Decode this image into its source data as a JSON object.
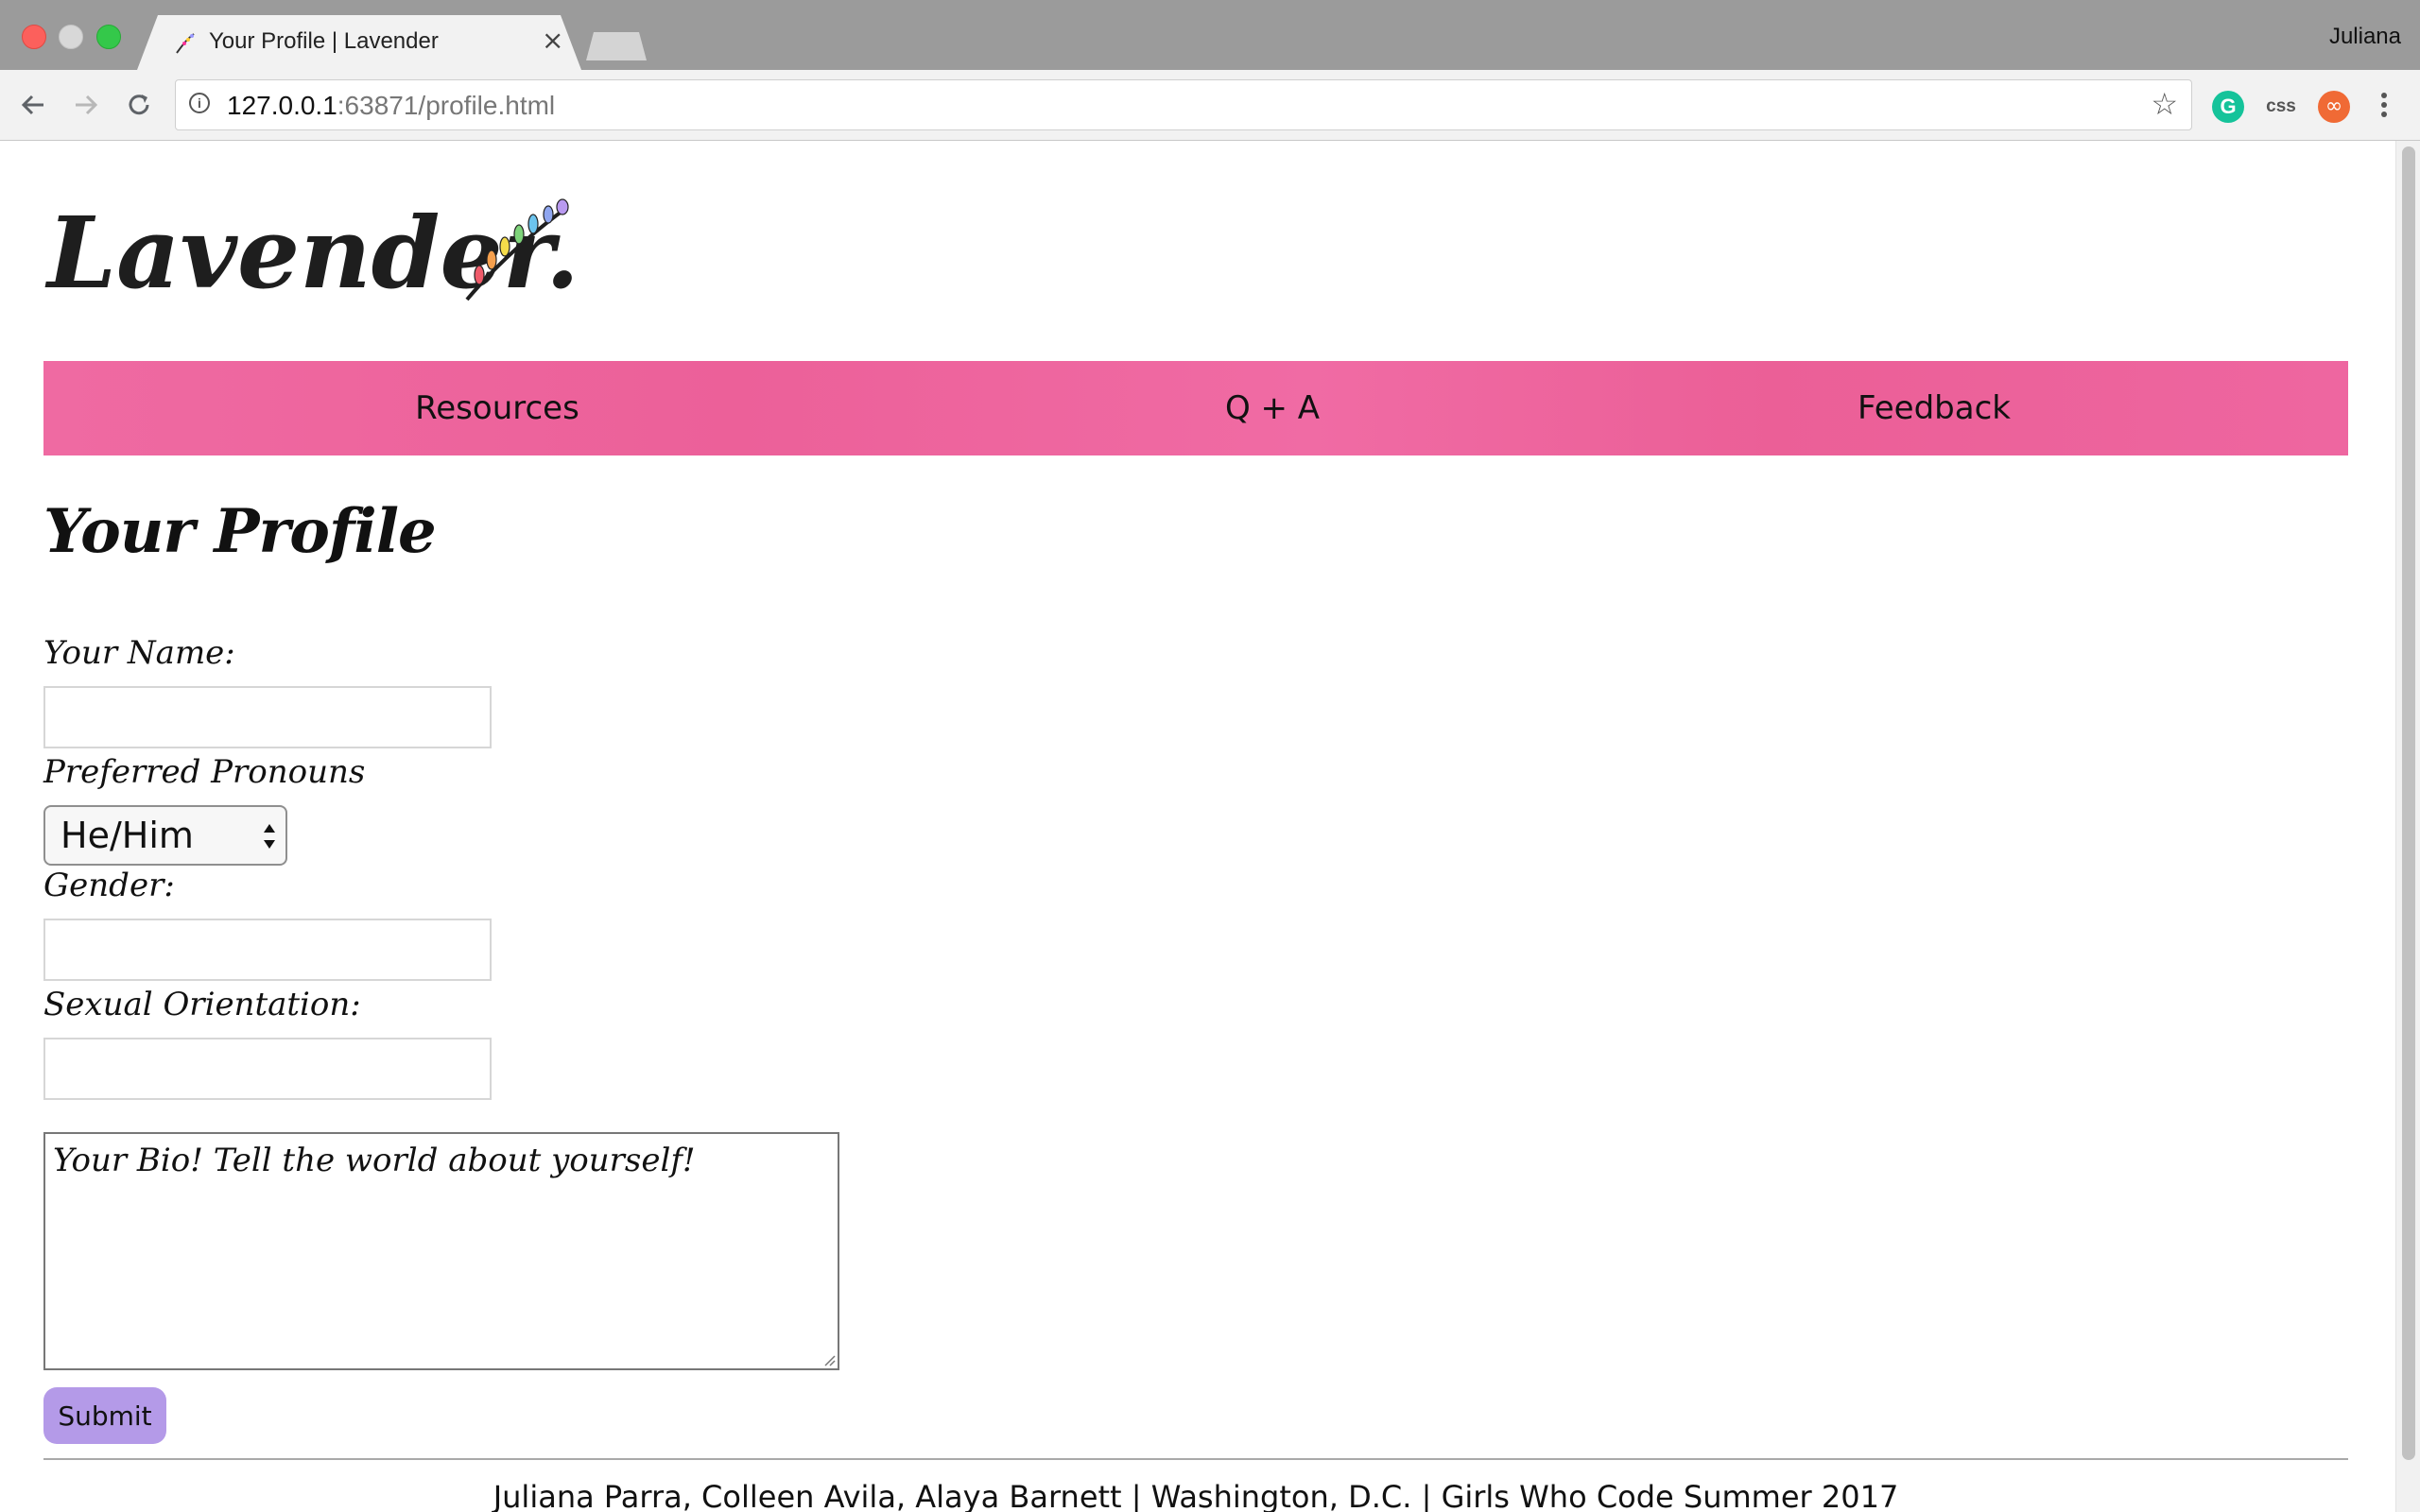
{
  "browser": {
    "tab_title": "Your Profile | Lavender",
    "profile_name": "Juliana",
    "url_host": "127.0.0.1",
    "url_rest": ":63871/profile.html",
    "extensions": {
      "grammarly": "G",
      "css": "css",
      "infinity": "∞"
    }
  },
  "site": {
    "logo_text": "Lavender.",
    "nav": [
      "Resources",
      "Q + A",
      "Feedback"
    ],
    "nav_color": "#ee66a0"
  },
  "page": {
    "title": "Your Profile",
    "form": {
      "name_label": "Your Name:",
      "name_value": "",
      "pronouns_label": "Preferred Pronouns",
      "pronouns_selected": "He/Him",
      "gender_label": "Gender:",
      "gender_value": "",
      "orientation_label": "Sexual Orientation:",
      "orientation_value": "",
      "bio_placeholder": "Your Bio! Tell the world about yourself!",
      "submit_label": "Submit",
      "submit_color": "#b49ae8"
    },
    "footer": "Juliana Parra, Colleen Avila, Alaya Barnett | Washington, D.C. | Girls Who Code Summer 2017"
  }
}
